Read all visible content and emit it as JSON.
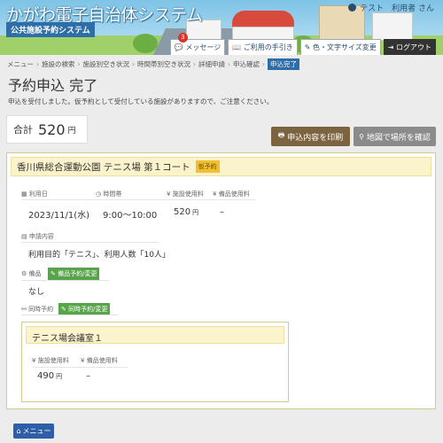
{
  "header": {
    "app_title": "かがわ電子自治体システム",
    "app_subtitle": "公共施設予約システム",
    "user_label": "テスト　利用者 さん",
    "toolbar": [
      {
        "label": "メッセージ",
        "icon": "chat-icon",
        "badge": "3"
      },
      {
        "label": "ご利用の手引き",
        "icon": "book-icon"
      },
      {
        "label": "色・文字サイズ変更",
        "icon": "pen-icon"
      },
      {
        "label": "ログアウト",
        "icon": "logout-icon"
      }
    ]
  },
  "breadcrumb": [
    "メニュー",
    "施設の検索",
    "施設別空き状況",
    "時間帯別空き状況",
    "詳細申請",
    "申込確認"
  ],
  "breadcrumb_current": "申込完了",
  "page": {
    "title": "予約申込 完了",
    "notice": "申込を受付しました。仮予約として受付している施設がありますので、ご注意ください。"
  },
  "total": {
    "label": "合計",
    "value": "520",
    "unit": "円"
  },
  "buttons": {
    "print": "申込内容を印刷",
    "map": "地図で場所を確認",
    "menu": "メニュー"
  },
  "reservation": {
    "facility": "香川県総合運動公園 テニス場 第１コート",
    "tag": "仮予約",
    "date_label": "利用日",
    "date": "2023/11/1(水)",
    "time_label": "時間帯",
    "time": "9:00～10:00",
    "fee_label": "施設使用料",
    "fee": "520",
    "fee_unit": "円",
    "equip_fee_label": "備品使用料",
    "equip_fee": "–",
    "purpose_label": "申請内容",
    "purpose": "利用目的「テニス」、利用人数「10人」",
    "equipment_label": "備品",
    "equipment_button": "備品予約/変更",
    "equipment_value": "なし",
    "simul_label": "同時予約",
    "simul_button": "同時予約/変更"
  },
  "simul_reservation": {
    "facility": "テニス場会議室１",
    "fee_label": "施設使用料",
    "fee": "490",
    "fee_unit": "円",
    "equip_fee_label": "備品使用料",
    "equip_fee": "–"
  },
  "colors": {
    "brand": "#2e6ea8",
    "print_button": "#7d6440",
    "map_button": "#8b8b8b",
    "green": "#58a44a",
    "card_head": "#fbf3cb"
  }
}
